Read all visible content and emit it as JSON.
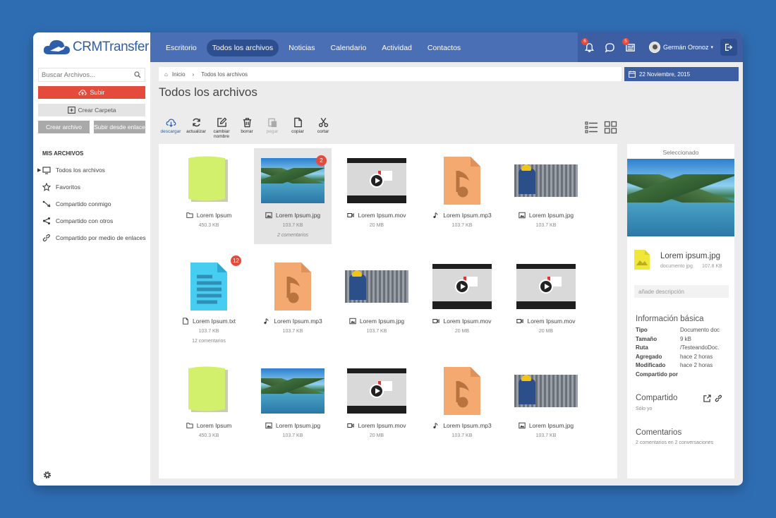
{
  "app": {
    "logo_text": "CRMTransfer"
  },
  "nav": {
    "tabs": [
      {
        "label": "Escritorio"
      },
      {
        "label": "Todos los archivos",
        "active": true
      },
      {
        "label": "Noticias"
      },
      {
        "label": "Calendario"
      },
      {
        "label": "Actividad"
      },
      {
        "label": "Contactos"
      }
    ],
    "notifications": [
      {
        "icon": "bell-icon",
        "badge": "6"
      },
      {
        "icon": "chat-icon",
        "badge": ""
      },
      {
        "icon": "news-icon",
        "badge": "5"
      }
    ],
    "user_name": "Germán Oronoz"
  },
  "sidebar": {
    "search_placeholder": "Buscar Archivos...",
    "upload_label": "Subir",
    "create_folder_label": "Crear Carpeta",
    "create_file_label": "Crear archivo",
    "upload_link_label": "Subir desde enlace",
    "section_title": "MIS ARCHIVOS",
    "items": [
      {
        "label": "Todos los archivos",
        "icon": "monitor-icon",
        "active": true
      },
      {
        "label": "Favoritos",
        "icon": "star-icon"
      },
      {
        "label": "Compartido conmigo",
        "icon": "share-in-icon"
      },
      {
        "label": "Compartido con otros",
        "icon": "share-icon"
      },
      {
        "label": "Compartido por medio de enlaces",
        "icon": "link-icon"
      }
    ]
  },
  "breadcrumb": {
    "home": "Inicio",
    "current": "Todos los archivos"
  },
  "date": "22 Noviembre, 2015",
  "page_title": "Todos los archivos",
  "toolbar": [
    {
      "label": "descargar",
      "icon": "download-icon",
      "state": "primary"
    },
    {
      "label": "actualizar",
      "icon": "refresh-icon",
      "state": "normal"
    },
    {
      "label": "cambiar nombre",
      "icon": "edit-icon",
      "state": "normal"
    },
    {
      "label": "borrar",
      "icon": "trash-icon",
      "state": "normal"
    },
    {
      "label": "pegar",
      "icon": "paste-icon",
      "state": "disabled"
    },
    {
      "label": "copiar",
      "icon": "copy-icon",
      "state": "normal"
    },
    {
      "label": "cortar",
      "icon": "scissors-icon",
      "state": "normal"
    }
  ],
  "files": [
    {
      "name": "Lorem Ipsum",
      "kind": "folder",
      "size": "450.3 KB"
    },
    {
      "name": "Lorem Ipsum.jpg",
      "kind": "lake",
      "size": "103.7 KB",
      "comments": "2 comentarios",
      "badge": "2",
      "selected": true
    },
    {
      "name": "Lorem Ipsum.mov",
      "kind": "video",
      "size": "20 MB"
    },
    {
      "name": "Lorem Ipsum.mp3",
      "kind": "audio",
      "size": "103.7 KB"
    },
    {
      "name": "Lorem Ipsum.jpg",
      "kind": "gear",
      "size": "103.7 KB"
    },
    {
      "name": "Lorem Ipsum.txt",
      "kind": "text",
      "size": "103.7 KB",
      "comments": "12 comentarios",
      "badge": "12"
    },
    {
      "name": "Lorem Ipsum.mp3",
      "kind": "audio",
      "size": "103.7 KB"
    },
    {
      "name": "Lorem Ipsum.jpg",
      "kind": "gear",
      "size": "103.7 KB"
    },
    {
      "name": "Lorem Ipsum.mov",
      "kind": "video",
      "size": "20 MB"
    },
    {
      "name": "Lorem Ipsum.mov",
      "kind": "video",
      "size": "20 MB"
    },
    {
      "name": "Lorem Ipsum",
      "kind": "folder",
      "size": "450.3 KB"
    },
    {
      "name": "Lorem Ipsum.jpg",
      "kind": "lake",
      "size": "103.7 KB"
    },
    {
      "name": "Lorem Ipsum.mov",
      "kind": "video",
      "size": "20 MB"
    },
    {
      "name": "Lorem Ipsum.mp3",
      "kind": "audio",
      "size": "103.7 KB"
    },
    {
      "name": "Lorem Ipsum.jpg",
      "kind": "gear",
      "size": "103.7 KB"
    }
  ],
  "details": {
    "selected_label": "Seleccionado",
    "file_name": "Lorem ipsum.jpg",
    "file_type": "documento jpg",
    "file_size": "107.8 KB",
    "description_placeholder": "añade descripción",
    "info_title": "Información básica",
    "info": [
      {
        "key": "Tipo",
        "value": "Documento doc"
      },
      {
        "key": "Tamaño",
        "value": "9 kB"
      },
      {
        "key": "Ruta",
        "value": "/TesteandoDoc."
      },
      {
        "key": "Agregado",
        "value": "hace 2 horas"
      },
      {
        "key": "Modificado",
        "value": "hace 2 horas"
      },
      {
        "key": "Compartido por",
        "value": ""
      }
    ],
    "shared_title": "Compartido",
    "shared_text": "Sólo yo",
    "comments_title": "Comentarios",
    "comments_text": "2 comentarios en 2 conversaciones"
  },
  "colors": {
    "nav": "#4b6fb5",
    "nav_dark": "#3d5ea2",
    "accent_red": "#e54b3c",
    "background": "#2f6db3"
  }
}
